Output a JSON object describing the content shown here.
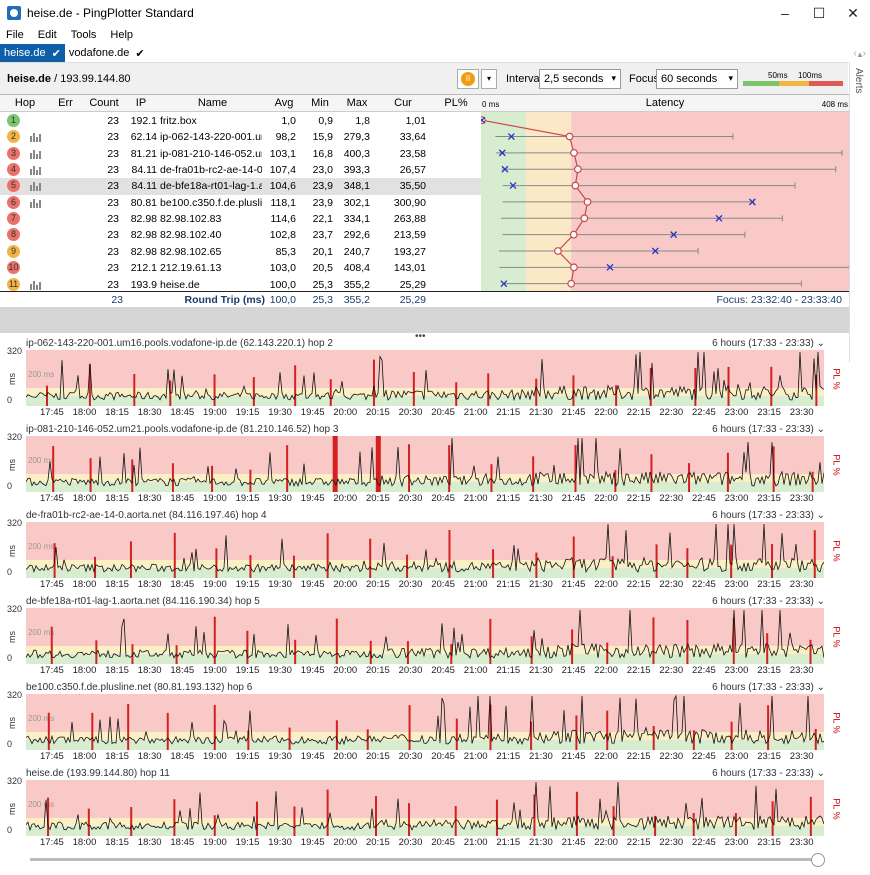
{
  "window": {
    "title": "heise.de - PingPlotter Standard"
  },
  "menu": [
    "File",
    "Edit",
    "Tools",
    "Help"
  ],
  "tabs": [
    {
      "label": "heise.de",
      "active": true
    },
    {
      "label": "vodafone.de",
      "active": false
    }
  ],
  "header": {
    "target_name": "heise.de",
    "target_ip": "/ 193.99.144.80",
    "interval_label": "Interval",
    "interval_value": "2,5 seconds",
    "focus_label": "Focus",
    "focus_value": "60 seconds",
    "legend_50": "50ms",
    "legend_100": "100ms"
  },
  "alerts_label": "Alerts",
  "columns": [
    "Hop",
    "Err",
    "Count",
    "IP",
    "Name",
    "Avg",
    "Min",
    "Max",
    "Cur",
    "PL%"
  ],
  "latency_header": {
    "left": "0 ms",
    "title": "Latency",
    "right": "408 ms"
  },
  "hops": [
    {
      "hop": "1",
      "color": "#7cc36b",
      "bars": false,
      "count": "23",
      "ip": "192.1",
      "name": "fritz.box",
      "avg": "1,0",
      "min": "0,9",
      "max": "1,8",
      "cur": "1,01",
      "circle": 1,
      "x": 1,
      "lo": 0.9,
      "hi": 1.8
    },
    {
      "hop": "2",
      "color": "#f0b545",
      "bars": true,
      "count": "23",
      "ip": "62.14",
      "name": "ip-062-143-220-001.ur",
      "avg": "98,2",
      "min": "15,9",
      "max": "279,3",
      "cur": "33,64",
      "circle": 98.2,
      "x": 33.64,
      "lo": 15.9,
      "hi": 279.3
    },
    {
      "hop": "3",
      "color": "#e9736a",
      "bars": true,
      "count": "23",
      "ip": "81.21",
      "name": "ip-081-210-146-052.ur",
      "avg": "103,1",
      "min": "16,8",
      "max": "400,3",
      "cur": "23,58",
      "circle": 103.1,
      "x": 23.58,
      "lo": 16.8,
      "hi": 400.3
    },
    {
      "hop": "4",
      "color": "#e9736a",
      "bars": true,
      "count": "23",
      "ip": "84.11",
      "name": "de-fra01b-rc2-ae-14-0.",
      "avg": "107,4",
      "min": "23,0",
      "max": "393,3",
      "cur": "26,57",
      "circle": 107.4,
      "x": 26.57,
      "lo": 23.0,
      "hi": 393.3
    },
    {
      "hop": "5",
      "color": "#e9736a",
      "bars": true,
      "count": "23",
      "ip": "84.11",
      "name": "de-bfe18a-rt01-lag-1.a",
      "avg": "104,6",
      "min": "23,9",
      "max": "348,1",
      "cur": "35,50",
      "circle": 104.6,
      "x": 35.5,
      "lo": 23.9,
      "hi": 348.1
    },
    {
      "hop": "6",
      "color": "#e9736a",
      "bars": true,
      "count": "23",
      "ip": "80.81",
      "name": "be100.c350.f.de.plusline",
      "avg": "118,1",
      "min": "23,9",
      "max": "302,1",
      "cur": "300,90",
      "circle": 118.1,
      "x": 300.9,
      "lo": 23.9,
      "hi": 302.1
    },
    {
      "hop": "7",
      "color": "#e9736a",
      "bars": false,
      "count": "23",
      "ip": "82.98",
      "name": "82.98.102.83",
      "avg": "114,6",
      "min": "22,1",
      "max": "334,1",
      "cur": "263,88",
      "circle": 114.6,
      "x": 263.88,
      "lo": 22.1,
      "hi": 334.1
    },
    {
      "hop": "8",
      "color": "#e9736a",
      "bars": false,
      "count": "23",
      "ip": "82.98",
      "name": "82.98.102.40",
      "avg": "102,8",
      "min": "23,7",
      "max": "292,6",
      "cur": "213,59",
      "circle": 102.8,
      "x": 213.59,
      "lo": 23.7,
      "hi": 292.6
    },
    {
      "hop": "9",
      "color": "#f0b545",
      "bars": false,
      "count": "23",
      "ip": "82.98",
      "name": "82.98.102.65",
      "avg": "85,3",
      "min": "20,1",
      "max": "240,7",
      "cur": "193,27",
      "circle": 85.3,
      "x": 193.27,
      "lo": 20.1,
      "hi": 240.7
    },
    {
      "hop": "10",
      "color": "#e9736a",
      "bars": false,
      "count": "23",
      "ip": "212.1",
      "name": "212.19.61.13",
      "avg": "103,0",
      "min": "20,5",
      "max": "408,4",
      "cur": "143,01",
      "circle": 103.0,
      "x": 143.01,
      "lo": 20.5,
      "hi": 408.4
    },
    {
      "hop": "11",
      "color": "#f0b545",
      "bars": true,
      "count": "23",
      "ip": "193.9",
      "name": "heise.de",
      "avg": "100,0",
      "min": "25,3",
      "max": "355,2",
      "cur": "25,29",
      "circle": 100.0,
      "x": 25.29,
      "lo": 25.3,
      "hi": 355.2
    }
  ],
  "round_trip": {
    "count": "23",
    "label": "Round Trip (ms)",
    "avg": "100,0",
    "min": "25,3",
    "max": "355,2",
    "cur": "25,29",
    "focus": "Focus: 23:32:40 - 23:33:40"
  },
  "graphs": [
    {
      "title": "ip-062-143-220-001.um16.pools.vodafone-ip.de (62.143.220.1) hop 2",
      "range": "6 hours (17:33 - 23:33)"
    },
    {
      "title": "ip-081-210-146-052.um21.pools.vodafone-ip.de (81.210.146.52) hop 3",
      "range": "6 hours (17:33 - 23:33)"
    },
    {
      "title": "de-fra01b-rc2-ae-14-0.aorta.net (84.116.197.46) hop 4",
      "range": "6 hours (17:33 - 23:33)"
    },
    {
      "title": "de-bfe18a-rt01-lag-1.aorta.net (84.116.190.34) hop 5",
      "range": "6 hours (17:33 - 23:33)"
    },
    {
      "title": "be100.c350.f.de.plusline.net (80.81.193.132) hop 6",
      "range": "6 hours (17:33 - 23:33)"
    },
    {
      "title": "heise.de (193.99.144.80) hop 11",
      "range": "6 hours (17:33 - 23:33)"
    }
  ],
  "graph_axis": {
    "y_top": "320",
    "y_mid": "200 ms",
    "y_zero": "0",
    "ms": "ms",
    "pl": "PL %",
    "ticks": [
      "17:45",
      "18:00",
      "18:15",
      "18:30",
      "18:45",
      "19:00",
      "19:15",
      "19:30",
      "19:45",
      "20:00",
      "20:15",
      "20:30",
      "20:45",
      "21:00",
      "21:15",
      "21:30",
      "21:45",
      "22:00",
      "22:15",
      "22:30",
      "22:45",
      "23:00",
      "23:15",
      "23:30"
    ]
  },
  "colors": {
    "good": "#d8ecd0",
    "warn": "#fbefc6",
    "bad": "#f8c9c6",
    "accent": "#0f5fa8"
  }
}
